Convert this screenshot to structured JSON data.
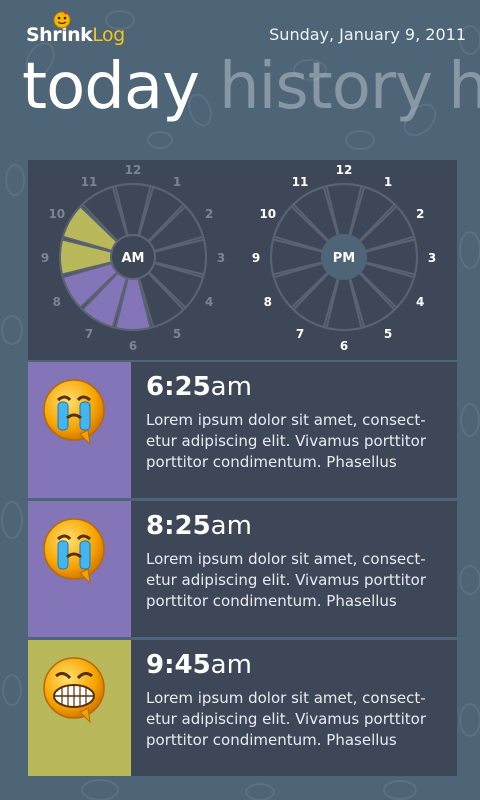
{
  "header": {
    "logo_part1": "Shrink",
    "logo_part2": "Log",
    "date": "Sunday, January 9, 2011"
  },
  "pivot": {
    "current": "today",
    "next": "history",
    "next_partial": "h"
  },
  "clocks": {
    "am": {
      "label": "AM",
      "hours": [
        "12",
        "1",
        "2",
        "3",
        "4",
        "5",
        "6",
        "7",
        "8",
        "9",
        "10",
        "11"
      ],
      "highlight": [
        {
          "hour": "9",
          "color": "#b9b85a"
        },
        {
          "hour": "10",
          "color": "#b9b85a"
        },
        {
          "hour": "6",
          "color": "#8474b8"
        },
        {
          "hour": "7",
          "color": "#8474b8"
        },
        {
          "hour": "8",
          "color": "#8474b8"
        }
      ]
    },
    "pm": {
      "label": "PM",
      "hours": [
        "12",
        "1",
        "2",
        "3",
        "4",
        "5",
        "6",
        "7",
        "8",
        "9",
        "10",
        "11"
      ],
      "highlight": []
    }
  },
  "colors": {
    "sad": "#8474b8",
    "happy": "#b9b85a",
    "panel": "#3d4757",
    "bg": "#4e6477"
  },
  "entries": [
    {
      "mood": "crying",
      "icon": "crying-face-icon",
      "color": "#8474b8",
      "time": "6:25",
      "ampm": "am",
      "text": "Lorem ipsum dolor sit amet, consect-etur adipiscing elit. Vivamus porttitor porttitor condimentum. Phasellus"
    },
    {
      "mood": "crying",
      "icon": "crying-face-icon",
      "color": "#8474b8",
      "time": "8:25",
      "ampm": "am",
      "text": "Lorem ipsum dolor sit amet, consect-etur adipiscing elit. Vivamus porttitor porttitor condimentum. Phasellus"
    },
    {
      "mood": "grinning",
      "icon": "grinning-face-icon",
      "color": "#b9b85a",
      "time": "9:45",
      "ampm": "am",
      "text": "Lorem ipsum dolor sit amet, consect-etur adipiscing elit. Vivamus porttitor porttitor condimentum. Phasellus"
    }
  ]
}
